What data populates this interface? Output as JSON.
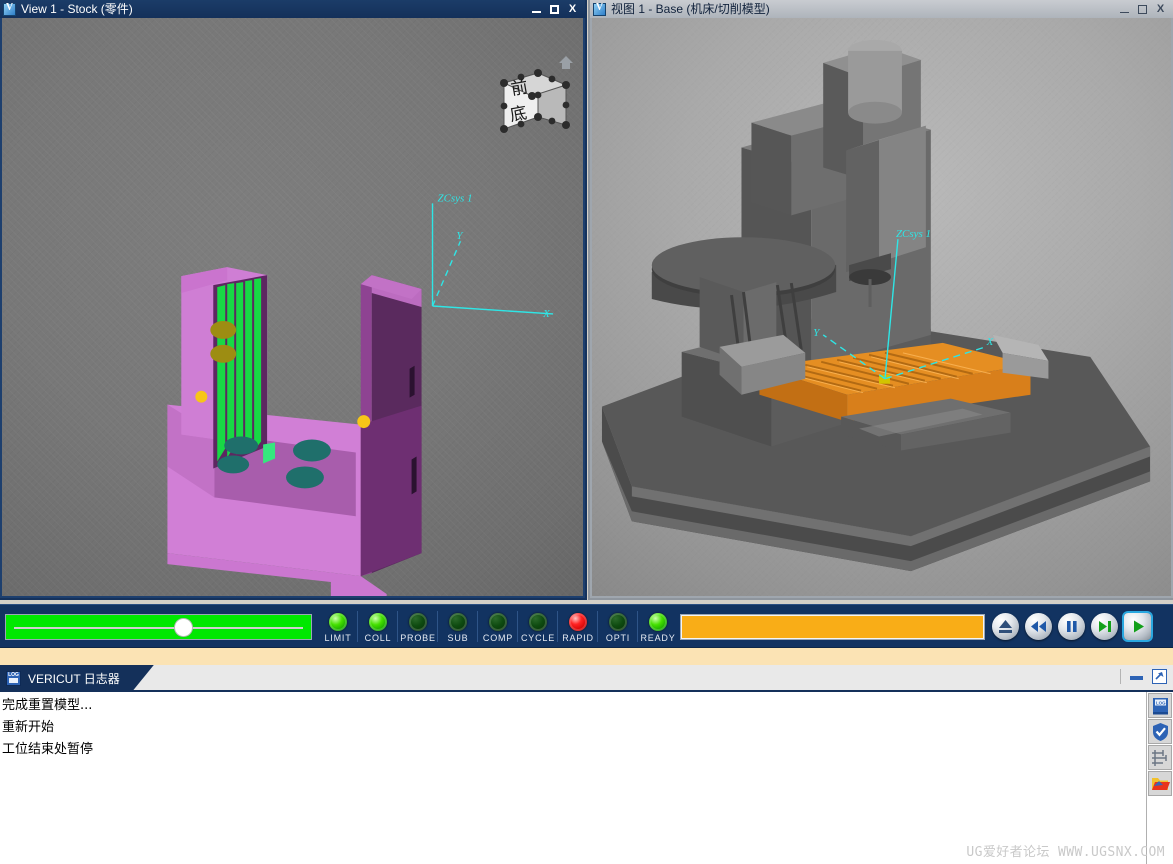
{
  "views": [
    {
      "id": "stock",
      "title": "View 1 - Stock (零件)",
      "active": true,
      "icon": "vericut-v-icon",
      "window_buttons": {
        "minimize": "–",
        "maximize": "□",
        "close": "X"
      },
      "csys_label": "ZCsys 1",
      "axis_x": "X",
      "axis_y": "Y",
      "viewcube": {
        "front_face": "前",
        "bottom_face": "底",
        "home": "home-icon"
      }
    },
    {
      "id": "base",
      "title": "视图 1 - Base (机床/切削模型)",
      "active": false,
      "icon": "vericut-v-icon",
      "window_buttons": {
        "minimize": "–",
        "maximize": "□",
        "close": "X"
      },
      "csys_label": "ZCsys 1",
      "axis_x": "X",
      "axis_y": "Y"
    }
  ],
  "statusbar": {
    "speed_slider": {
      "name": "simulation-speed-slider",
      "value_percent": 58,
      "fill_color": "#00e800"
    },
    "lights": [
      {
        "label": "LIMIT",
        "state": "on",
        "color": "#45e000"
      },
      {
        "label": "COLL",
        "state": "on",
        "color": "#45e000"
      },
      {
        "label": "PROBE",
        "state": "off",
        "color": "#0e4a10"
      },
      {
        "label": "SUB",
        "state": "off",
        "color": "#0e4a10"
      },
      {
        "label": "COMP",
        "state": "off",
        "color": "#0e4a10"
      },
      {
        "label": "CYCLE",
        "state": "off",
        "color": "#0e4a10"
      },
      {
        "label": "RAPID",
        "state": "on",
        "color": "#ff2222"
      },
      {
        "label": "OPTI",
        "state": "off",
        "color": "#0e4a10"
      },
      {
        "label": "READY",
        "state": "on",
        "color": "#45e000"
      }
    ],
    "progress": {
      "name": "simulation-progress-bar",
      "value_percent": 100,
      "fill_color": "#f9ad17"
    },
    "transport": [
      {
        "name": "reset-button",
        "icon": "eject-triangle-icon",
        "selected": false
      },
      {
        "name": "rewind-button",
        "icon": "rewind-double-left-icon",
        "selected": false
      },
      {
        "name": "pause-button",
        "icon": "pause-icon",
        "selected": false
      },
      {
        "name": "single-step-button",
        "icon": "step-forward-icon",
        "selected": false
      },
      {
        "name": "play-button",
        "icon": "play-icon",
        "selected": true
      }
    ]
  },
  "log_panel": {
    "tab_title": "VERICUT 日志器",
    "tab_icon": "log-book-icon",
    "window_buttons": {
      "minimize": "minimize-icon",
      "detach": "external-window-icon"
    },
    "lines": [
      "完成重置模型...",
      "重新开始",
      "工位结束处暂停"
    ],
    "side_buttons": [
      {
        "name": "log-book-icon"
      },
      {
        "name": "shield-check-icon"
      },
      {
        "name": "tree-filter-icon"
      },
      {
        "name": "folder-open-icon"
      }
    ]
  },
  "watermark": "UG爱好者论坛 WWW.UGSNX.COM",
  "colors": {
    "active_title": "#14305a",
    "inactive_title": "#b4bac1",
    "statusbar_bg": "#123361",
    "strip": "#fbe3b4",
    "stock_part": "#cc66cc",
    "machine_table": "#e08524",
    "csys": "#2ee6e6"
  }
}
